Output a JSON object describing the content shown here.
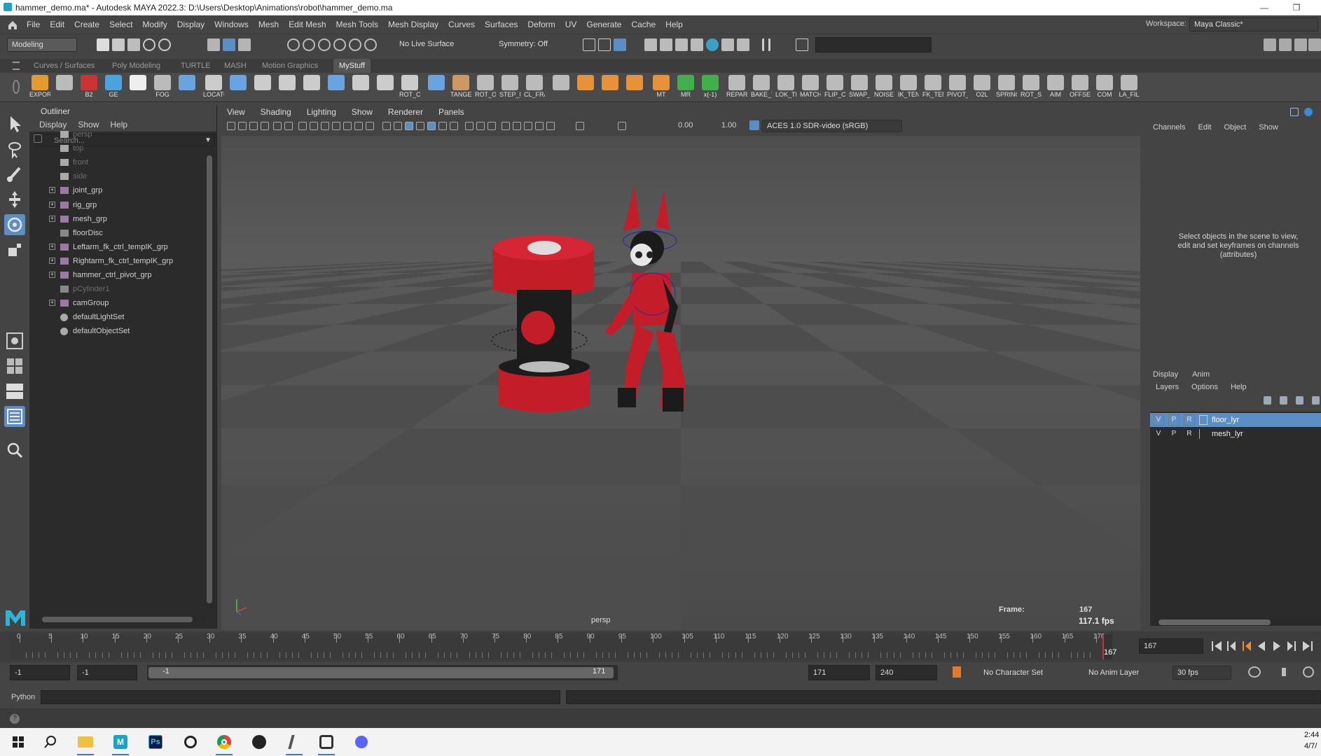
{
  "window": {
    "title": "hammer_demo.ma* - Autodesk MAYA 2022.3: D:\\Users\\Desktop\\Animations\\robot\\hammer_demo.ma"
  },
  "menubar": {
    "items": [
      "File",
      "Edit",
      "Create",
      "Select",
      "Modify",
      "Display",
      "Windows",
      "Mesh",
      "Edit Mesh",
      "Mesh Tools",
      "Mesh Display",
      "Curves",
      "Surfaces",
      "Deform",
      "UV",
      "Generate",
      "Cache",
      "Help"
    ],
    "workspace_label": "Workspace:",
    "workspace_value": "Maya Classic*"
  },
  "statusline": {
    "mode": "Modeling",
    "live_surface": "No Live Surface",
    "symmetry": "Symmetry: Off"
  },
  "shelf": {
    "tabs": [
      "Curves / Surfaces",
      "Poly Modeling",
      "TURTLE",
      "MASH",
      "Motion Graphics",
      "MyStuff"
    ],
    "active_tab": "MyStuff",
    "items": [
      "EXPOR",
      "",
      "B2",
      "GE",
      "",
      "FOG",
      "",
      "LOCATO",
      "",
      "",
      "",
      "",
      "",
      "",
      "",
      "ROT_CI",
      "",
      "TANGE",
      "ROT_OF",
      "STEP_M",
      "CL_FRA",
      "",
      "",
      "",
      "",
      "MT",
      "MR",
      "x(-1)",
      "REPAR",
      "BAKE_T",
      "LOK_TR",
      "MATCH",
      "FLIP_C",
      "SWAP_(",
      "NOISE",
      "IK_TEN",
      "FK_TEN",
      "PIVOT_",
      "O2L",
      "SPRING",
      "ROT_SP",
      "AIM",
      "OFFSET",
      "COM",
      "LA_FIL"
    ]
  },
  "outliner": {
    "title": "Outliner",
    "menu": [
      "Display",
      "Show",
      "Help"
    ],
    "search_placeholder": "Search...",
    "items": [
      {
        "label": "persp",
        "dim": true,
        "expand": false,
        "icon": "camera-icon"
      },
      {
        "label": "top",
        "dim": true,
        "expand": false,
        "icon": "camera-icon"
      },
      {
        "label": "front",
        "dim": true,
        "expand": false,
        "icon": "camera-icon"
      },
      {
        "label": "side",
        "dim": true,
        "expand": false,
        "icon": "camera-icon"
      },
      {
        "label": "joint_grp",
        "dim": false,
        "expand": true,
        "icon": "group-icon"
      },
      {
        "label": "rig_grp",
        "dim": false,
        "expand": true,
        "icon": "group-icon"
      },
      {
        "label": "mesh_grp",
        "dim": false,
        "expand": true,
        "icon": "group-icon"
      },
      {
        "label": "floorDisc",
        "dim": false,
        "expand": false,
        "icon": "curve-icon"
      },
      {
        "label": "Leftarm_fk_ctrl_tempIK_grp",
        "dim": false,
        "expand": true,
        "icon": "group-icon"
      },
      {
        "label": "Rightarm_fk_ctrl_tempIK_grp",
        "dim": false,
        "expand": true,
        "icon": "group-icon"
      },
      {
        "label": "hammer_ctrl_pivot_grp",
        "dim": false,
        "expand": true,
        "icon": "group-icon"
      },
      {
        "label": "pCylinder1",
        "dim": true,
        "expand": false,
        "icon": "curve-icon"
      },
      {
        "label": "camGroup",
        "dim": false,
        "expand": true,
        "icon": "group-icon"
      },
      {
        "label": "defaultLightSet",
        "dim": false,
        "expand": false,
        "icon": "set-icon"
      },
      {
        "label": "defaultObjectSet",
        "dim": false,
        "expand": false,
        "icon": "set-icon"
      }
    ]
  },
  "viewport": {
    "menu": [
      "View",
      "Shading",
      "Lighting",
      "Show",
      "Renderer",
      "Panels"
    ],
    "exposure": "0.00",
    "gamma": "1.00",
    "color_space": "ACES 1.0 SDR-video (sRGB)",
    "camera_label": "persp",
    "frame_label": "Frame:",
    "frame_value": "167",
    "fps": "117.1 fps"
  },
  "channelbox": {
    "menu": [
      "Channels",
      "Edit",
      "Object",
      "Show"
    ],
    "message": "Select objects in the scene to view, edit and set keyframes on channels (attributes)"
  },
  "layereditor": {
    "tabs": [
      "Display",
      "Anim"
    ],
    "menu": [
      "Layers",
      "Options",
      "Help"
    ],
    "layers": [
      {
        "name": "floor_lyr",
        "selected": true
      },
      {
        "name": "mesh_lyr",
        "selected": false
      }
    ],
    "vpr": [
      "V",
      "P",
      "R"
    ]
  },
  "timeline": {
    "ticks": [
      "0",
      "5",
      "10",
      "15",
      "20",
      "25",
      "30",
      "35",
      "40",
      "45",
      "50",
      "55",
      "60",
      "65",
      "70",
      "75",
      "80",
      "85",
      "90",
      "95",
      "100",
      "105",
      "110",
      "115",
      "120",
      "125",
      "130",
      "135",
      "140",
      "145",
      "150",
      "155",
      "160",
      "165",
      "170"
    ],
    "current_frame": "167",
    "current_frame_field": "167"
  },
  "range": {
    "start": "-1",
    "anim_start": "-1",
    "range_start": "-1",
    "range_end": "171",
    "end": "171",
    "anim_end": "240",
    "character_set": "No Character Set",
    "anim_layer": "No Anim Layer",
    "fps": "30 fps"
  },
  "cmdline": {
    "language": "Python"
  },
  "taskbar": {
    "time": "2:44",
    "date": "4/7/"
  }
}
